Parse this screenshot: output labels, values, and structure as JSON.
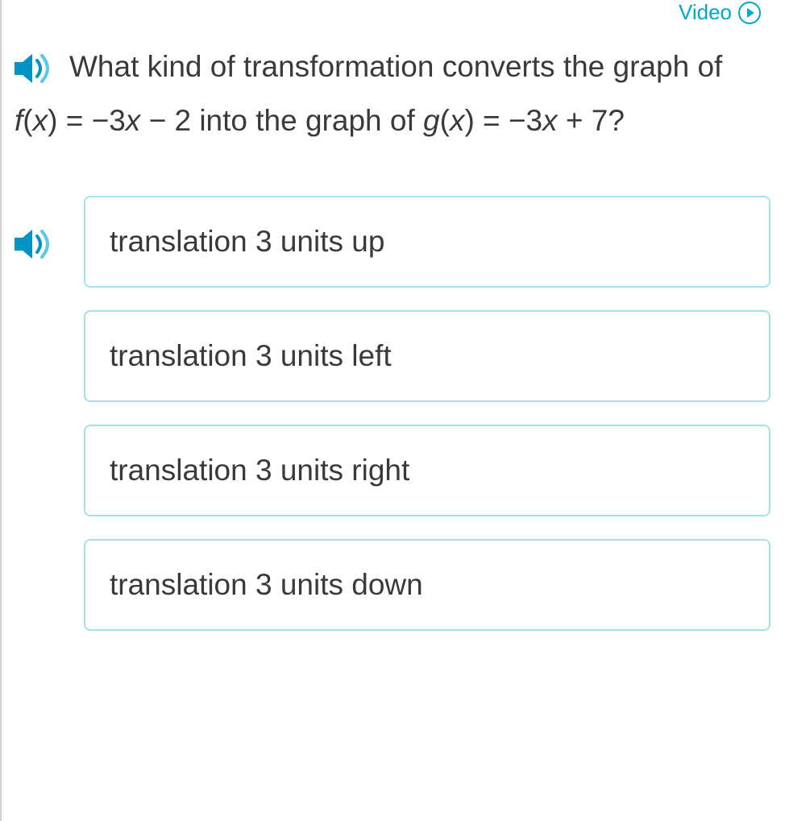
{
  "top": {
    "video_label": "Video"
  },
  "question": {
    "prefix": "What kind of transformation converts the graph of ",
    "fx_label": "f",
    "fx_paren": "(",
    "fx_var": "x",
    "fx_close": ")",
    "fx_eq": " = −3",
    "fx_var2": "x",
    "fx_rest": " − 2 into the graph of ",
    "gx_label": "g",
    "gx_paren": "(",
    "gx_var": "x",
    "gx_close": ")",
    "gx_eq": " = −3",
    "gx_var2": "x",
    "gx_rest": " + 7?"
  },
  "options": [
    {
      "label": "translation 3 units up"
    },
    {
      "label": "translation 3 units left"
    },
    {
      "label": "translation 3 units right"
    },
    {
      "label": "translation 3 units down"
    }
  ]
}
